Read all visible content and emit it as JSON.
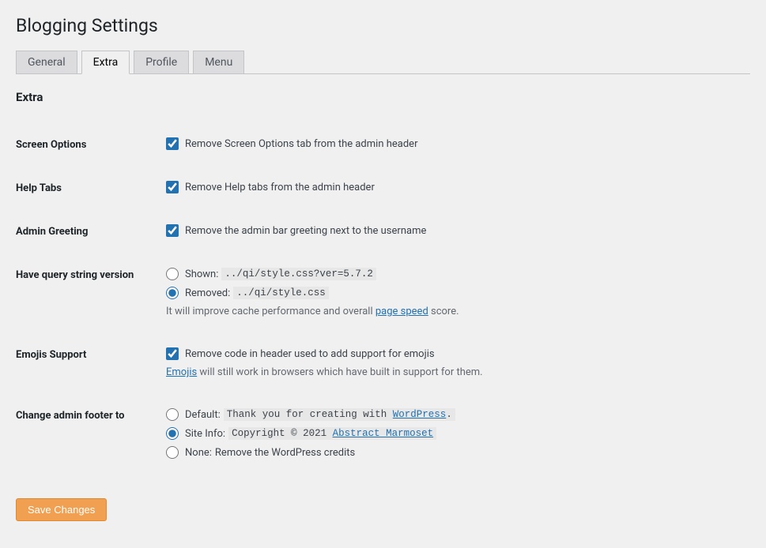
{
  "page_title": "Blogging Settings",
  "tabs": {
    "general": "General",
    "extra": "Extra",
    "profile": "Profile",
    "menu": "Menu"
  },
  "section_heading": "Extra",
  "rows": {
    "screen_options": {
      "heading": "Screen Options",
      "checkbox_label": "Remove Screen Options tab from the admin header"
    },
    "help_tabs": {
      "heading": "Help Tabs",
      "checkbox_label": "Remove Help tabs from the admin header"
    },
    "admin_greeting": {
      "heading": "Admin Greeting",
      "checkbox_label": "Remove the admin bar greeting next to the username"
    },
    "query_string": {
      "heading": "Have query string version",
      "shown_label": "Shown:",
      "shown_code": "../qi/style.css?ver=5.7.2",
      "removed_label": "Removed:",
      "removed_code": "../qi/style.css",
      "desc_before": "It will improve cache performance and overall ",
      "desc_link": "page speed",
      "desc_after": " score."
    },
    "emojis": {
      "heading": "Emojis Support",
      "checkbox_label": "Remove code in header used to add support for emojis",
      "desc_link": "Emojis",
      "desc_after": " will still work in browsers which have built in support for them."
    },
    "footer": {
      "heading": "Change admin footer to",
      "default_label": "Default:",
      "default_code_before": "Thank you for creating with ",
      "default_code_link": "WordPress",
      "default_code_after": ".",
      "siteinfo_label": "Site Info:",
      "siteinfo_code_before": "Copyright © 2021 ",
      "siteinfo_code_link": "Abstract Marmoset",
      "none_label": "None:",
      "none_text": "Remove the WordPress credits"
    }
  },
  "save_button": "Save Changes"
}
